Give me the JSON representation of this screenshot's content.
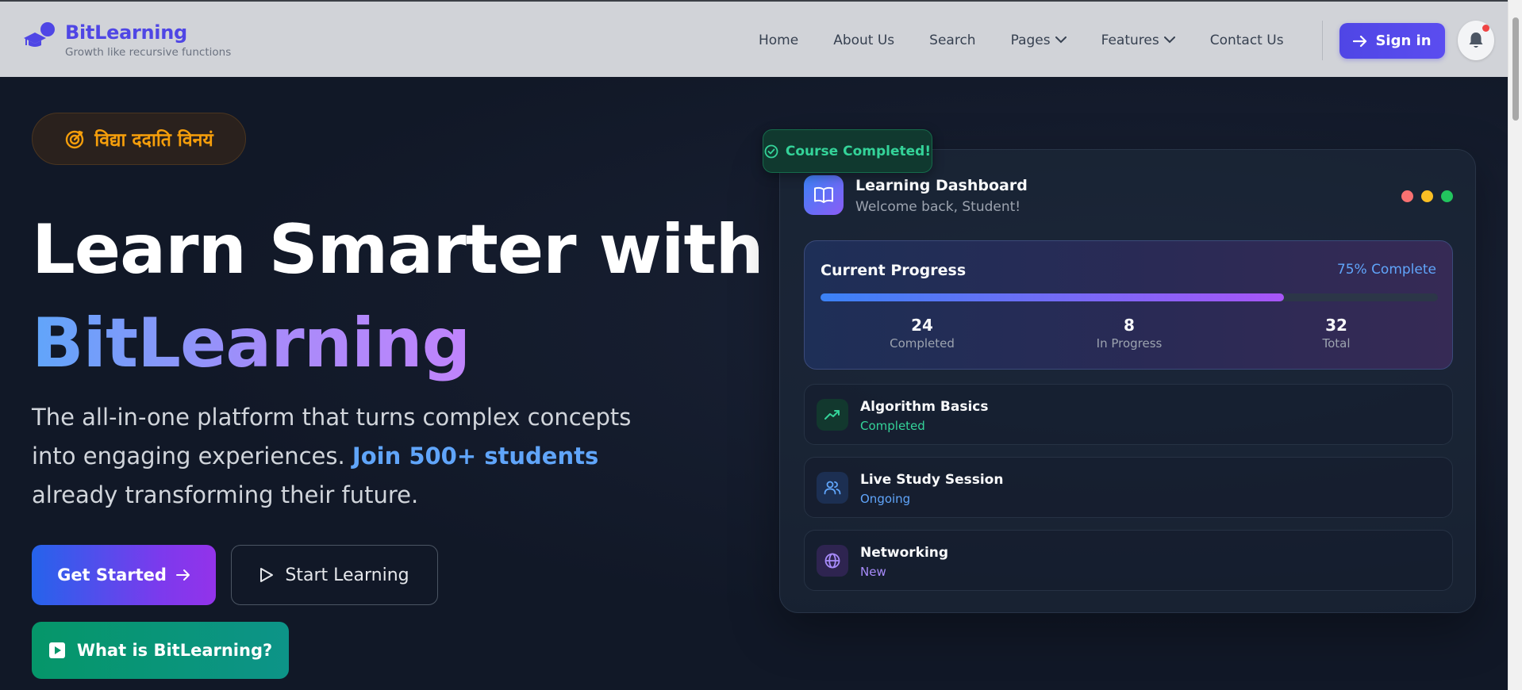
{
  "brand": {
    "name": "BitLearning",
    "tagline": "Growth like recursive functions",
    "logo_icon": "graduation-cap-icon"
  },
  "nav": {
    "items": [
      {
        "label": "Home"
      },
      {
        "label": "About Us"
      },
      {
        "label": "Search"
      },
      {
        "label": "Pages",
        "dropdown": true
      },
      {
        "label": "Features",
        "dropdown": true
      },
      {
        "label": "Contact Us"
      }
    ],
    "signin_label": "Sign in",
    "notification_icon": "bell-icon"
  },
  "hero": {
    "motto": "विद्या ददाति विनयं",
    "headline_line1": "Learn Smarter with",
    "headline_line2": "BitLearning",
    "lead_before": "The all-in-one platform that turns complex concepts into engaging experiences. ",
    "lead_highlight": "Join 500+ students",
    "lead_after": " already transforming their future.",
    "btn_get_started": "Get Started",
    "btn_start_learning": "Start Learning",
    "btn_what_is": "What is BitLearning?"
  },
  "dashboard": {
    "badge": "Course Completed!",
    "title": "Learning Dashboard",
    "subtitle": "Welcome back, Student!",
    "progress": {
      "title": "Current Progress",
      "percent_label": "75% Complete",
      "percent_value": 75,
      "stats": [
        {
          "value": "24",
          "label": "Completed"
        },
        {
          "value": "8",
          "label": "In Progress"
        },
        {
          "value": "32",
          "label": "Total"
        }
      ]
    },
    "items": [
      {
        "title": "Algorithm Basics",
        "status": "Completed",
        "icon": "trending-up-icon",
        "color": "#34d399"
      },
      {
        "title": "Live Study Session",
        "status": "Ongoing",
        "icon": "users-icon",
        "color": "#60a5fa"
      },
      {
        "title": "Networking",
        "status": "New",
        "icon": "globe-icon",
        "color": "#a78bfa"
      }
    ]
  },
  "colors": {
    "accent": "#4f46e5",
    "background": "#111827",
    "header": "#d1d3d8",
    "motto": "#f59e0b",
    "success": "#34d399"
  }
}
